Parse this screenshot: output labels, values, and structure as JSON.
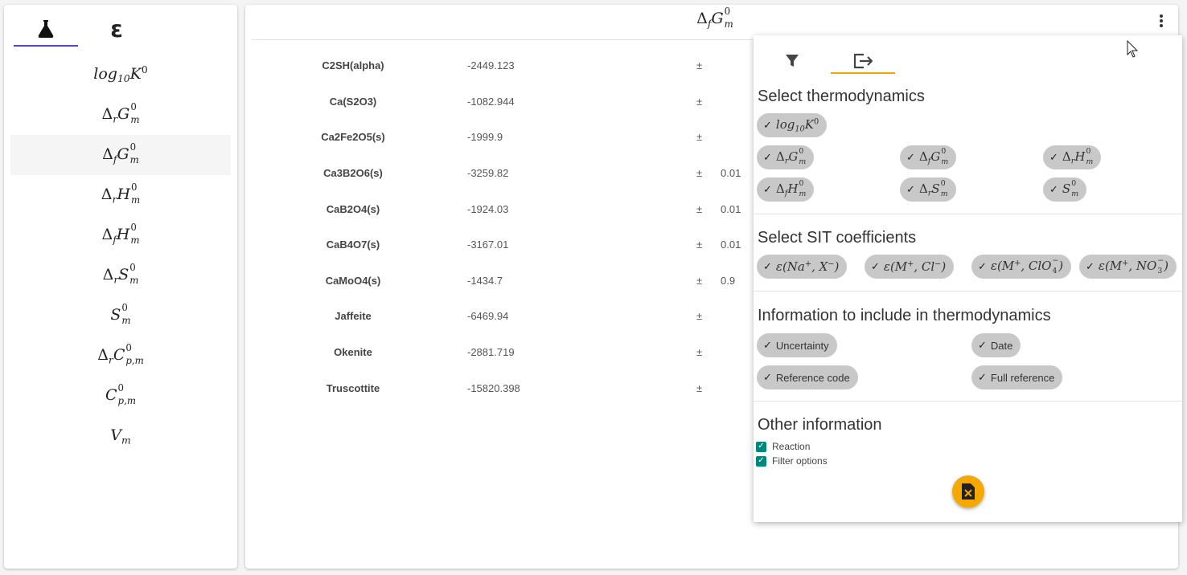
{
  "left_panel": {
    "tab_active_icon": "flask-icon",
    "tab_epsilon_label": "ε",
    "items": [
      {
        "prefix": "",
        "sub_pre": "",
        "base": "log",
        "sub": "10",
        "sup": "",
        "tail": "K",
        "tail_sup": "0"
      },
      {
        "prefix": "Δ",
        "sub_pre": "r",
        "base": "G",
        "sub": "m",
        "sup": "0"
      },
      {
        "prefix": "Δ",
        "sub_pre": "f",
        "base": "G",
        "sub": "m",
        "sup": "0"
      },
      {
        "prefix": "Δ",
        "sub_pre": "r",
        "base": "H",
        "sub": "m",
        "sup": "0"
      },
      {
        "prefix": "Δ",
        "sub_pre": "f",
        "base": "H",
        "sub": "m",
        "sup": "0"
      },
      {
        "prefix": "Δ",
        "sub_pre": "r",
        "base": "S",
        "sub": "m",
        "sup": "0"
      },
      {
        "prefix": "",
        "sub_pre": "",
        "base": "S",
        "sub": "m",
        "sup": "0"
      },
      {
        "prefix": "Δ",
        "sub_pre": "r",
        "base": "C",
        "sub": "p,m",
        "sup": "0"
      },
      {
        "prefix": "",
        "sub_pre": "",
        "base": "C",
        "sub": "p,m",
        "sup": "0"
      },
      {
        "prefix": "",
        "sub_pre": "",
        "base": "V",
        "sub": "m",
        "sup": ""
      }
    ],
    "active_index": 2
  },
  "main": {
    "title": {
      "prefix": "Δ",
      "sub_pre": "f",
      "base": "G",
      "sub": "m",
      "sup": "0"
    },
    "menu_icon": "more-vertical-icon",
    "pm_symbol": "±",
    "rows": [
      {
        "name": "C2SH(alpha)",
        "value": "-2449.123",
        "uncertainty": ""
      },
      {
        "name": "Ca(S2O3)",
        "value": "-1082.944",
        "uncertainty": ""
      },
      {
        "name": "Ca2Fe2O5(s)",
        "value": "-1999.9",
        "uncertainty": ""
      },
      {
        "name": "Ca3B2O6(s)",
        "value": "-3259.82",
        "uncertainty": "0.01"
      },
      {
        "name": "CaB2O4(s)",
        "value": "-1924.03",
        "uncertainty": "0.01"
      },
      {
        "name": "CaB4O7(s)",
        "value": "-3167.01",
        "uncertainty": "0.01"
      },
      {
        "name": "CaMoO4(s)",
        "value": "-1434.7",
        "uncertainty": "0.9"
      },
      {
        "name": "Jaffeite",
        "value": "-6469.94",
        "uncertainty": ""
      },
      {
        "name": "Okenite",
        "value": "-2881.719",
        "uncertainty": ""
      },
      {
        "name": "Truscottite",
        "value": "-15820.398",
        "uncertainty": ""
      }
    ]
  },
  "export_popup": {
    "tabs": [
      "filter-icon",
      "export-icon"
    ],
    "active_tab": 1,
    "thermo_title": "Select thermodynamics",
    "sit_title": "Select SIT coefficients",
    "info_title": "Information to include in thermodynamics",
    "info_chips": [
      "Uncertainty",
      "Date",
      "Reference code",
      "Full reference"
    ],
    "other_title": "Other information",
    "other_checkboxes": [
      "Reaction",
      "Filter options"
    ],
    "check_symbol": "✓",
    "export_button_icon": "excel-export-icon",
    "accent_color": "#f5a800",
    "checkbox_color": "#00897b"
  }
}
